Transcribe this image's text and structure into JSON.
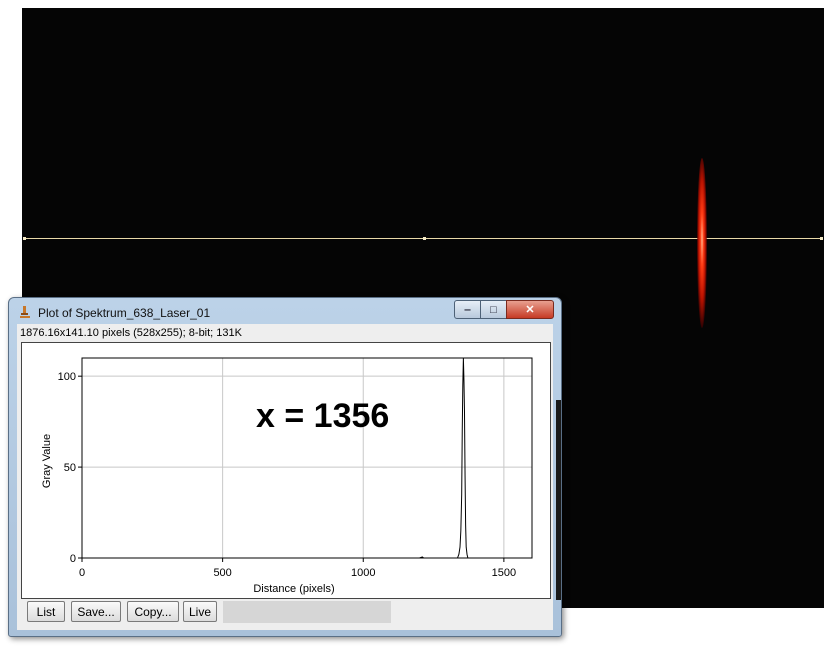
{
  "window": {
    "title": "Plot of Spektrum_638_Laser_01",
    "info": "1876.16x141.10 pixels (528x255); 8-bit; 131K",
    "min_glyph": "‒",
    "max_glyph": "□",
    "close_glyph": "✕"
  },
  "buttons": {
    "list": "List",
    "save": "Save...",
    "copy": "Copy...",
    "live": "Live"
  },
  "colors": {
    "image_background": "#050505",
    "profile_line": "#e8d9a8",
    "laser": "#ff3b14"
  },
  "chart_data": {
    "type": "line",
    "xlabel": "Distance (pixels)",
    "ylabel": "Gray Value",
    "xlim": [
      0,
      1600
    ],
    "ylim": [
      0,
      110
    ],
    "x_ticks": [
      0,
      500,
      1000,
      1500
    ],
    "y_ticks": [
      0,
      50,
      100
    ],
    "grid": true,
    "annotation": "x = 1356",
    "series": [
      {
        "x": [
          0,
          1200,
          1210,
          1215,
          1225,
          1335,
          1340,
          1344,
          1347,
          1350,
          1352,
          1354,
          1356,
          1358,
          1360,
          1362,
          1364,
          1366,
          1369,
          1372,
          1380,
          1600
        ],
        "y": [
          0,
          0,
          0.6,
          0,
          0,
          0,
          2,
          6,
          15,
          35,
          70,
          95,
          110,
          98,
          80,
          45,
          18,
          6,
          2,
          0,
          0,
          0
        ]
      }
    ]
  }
}
